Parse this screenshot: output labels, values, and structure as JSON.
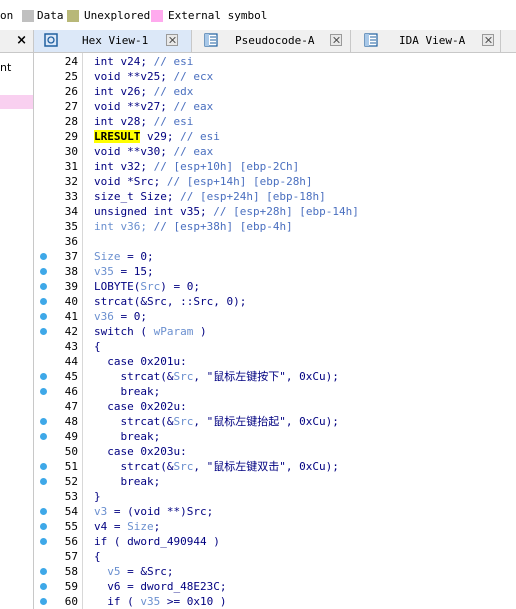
{
  "legend": [
    {
      "label": "on",
      "color": null
    },
    {
      "label": "Data",
      "color": "#c0c0c0"
    },
    {
      "label": "Unexplored",
      "color": "#b8b878"
    },
    {
      "label": "External symbol",
      "color": "#ffaaee"
    }
  ],
  "left_panel": {
    "close_glyph": "×",
    "fragment": "nt"
  },
  "tabs": [
    {
      "label": "Hex View-1",
      "icon": "hex-view-icon",
      "active": true
    },
    {
      "label": "Pseudocode-A",
      "icon": "pseudocode-icon",
      "active": false
    },
    {
      "label": "IDA View-A",
      "icon": "ida-view-icon",
      "active": false
    }
  ],
  "colors": {
    "breakpoint_dot": "#3ea8e8",
    "keyword": "#000080",
    "comment": "#4a6fbf",
    "highlight": "#ffff00"
  },
  "code_lines": [
    {
      "n": "24",
      "dot": false,
      "parts": [
        [
          "t",
          "int v24; "
        ],
        [
          "c",
          "// esi"
        ]
      ]
    },
    {
      "n": "25",
      "dot": false,
      "parts": [
        [
          "t",
          "void **v25; "
        ],
        [
          "c",
          "// ecx"
        ]
      ]
    },
    {
      "n": "26",
      "dot": false,
      "parts": [
        [
          "t",
          "int v26; "
        ],
        [
          "c",
          "// edx"
        ]
      ]
    },
    {
      "n": "27",
      "dot": false,
      "parts": [
        [
          "t",
          "void **v27; "
        ],
        [
          "c",
          "// eax"
        ]
      ]
    },
    {
      "n": "28",
      "dot": false,
      "parts": [
        [
          "t",
          "int v28; "
        ],
        [
          "c",
          "// esi"
        ]
      ]
    },
    {
      "n": "29",
      "dot": false,
      "parts": [
        [
          "h",
          "LRESULT"
        ],
        [
          "t",
          " v29; "
        ],
        [
          "c",
          "// esi"
        ]
      ]
    },
    {
      "n": "30",
      "dot": false,
      "parts": [
        [
          "t",
          "void **v30; "
        ],
        [
          "c",
          "// eax"
        ]
      ]
    },
    {
      "n": "31",
      "dot": false,
      "parts": [
        [
          "t",
          "int v32; "
        ],
        [
          "c",
          "// [esp+10h] [ebp-2Ch]"
        ]
      ]
    },
    {
      "n": "32",
      "dot": false,
      "parts": [
        [
          "t",
          "void *Src; "
        ],
        [
          "c",
          "// [esp+14h] [ebp-28h]"
        ]
      ]
    },
    {
      "n": "33",
      "dot": false,
      "parts": [
        [
          "t",
          "size_t Size; "
        ],
        [
          "c",
          "// [esp+24h] [ebp-18h]"
        ]
      ]
    },
    {
      "n": "34",
      "dot": false,
      "parts": [
        [
          "t",
          "unsigned int v35; "
        ],
        [
          "c",
          "// [esp+28h] [ebp-14h]"
        ]
      ]
    },
    {
      "n": "35",
      "dot": false,
      "parts": [
        [
          "g",
          "int v36; "
        ],
        [
          "c",
          "// [esp+38h] [ebp-4h]"
        ]
      ]
    },
    {
      "n": "36",
      "dot": false,
      "parts": []
    },
    {
      "n": "37",
      "dot": true,
      "parts": [
        [
          "g",
          "Size"
        ],
        [
          "t",
          " = 0;"
        ]
      ]
    },
    {
      "n": "38",
      "dot": true,
      "parts": [
        [
          "g",
          "v35"
        ],
        [
          "t",
          " = 15;"
        ]
      ]
    },
    {
      "n": "39",
      "dot": true,
      "parts": [
        [
          "t",
          "LOBYTE("
        ],
        [
          "g",
          "Src"
        ],
        [
          "t",
          ") = 0;"
        ]
      ]
    },
    {
      "n": "40",
      "dot": true,
      "parts": [
        [
          "t",
          "strcat(&Src, ::Src, 0);"
        ]
      ]
    },
    {
      "n": "41",
      "dot": true,
      "parts": [
        [
          "g",
          "v36"
        ],
        [
          "t",
          " = 0;"
        ]
      ]
    },
    {
      "n": "42",
      "dot": true,
      "parts": [
        [
          "t",
          "switch ( "
        ],
        [
          "g",
          "wParam"
        ],
        [
          "t",
          " )"
        ]
      ]
    },
    {
      "n": "43",
      "dot": false,
      "parts": [
        [
          "t",
          "{"
        ]
      ]
    },
    {
      "n": "44",
      "dot": false,
      "parts": [
        [
          "t",
          "  case 0x201u:"
        ]
      ]
    },
    {
      "n": "45",
      "dot": true,
      "parts": [
        [
          "t",
          "    strcat(&"
        ],
        [
          "g",
          "Src"
        ],
        [
          "t",
          ", \"鼠标左键按下\", 0xCu);"
        ]
      ]
    },
    {
      "n": "46",
      "dot": true,
      "parts": [
        [
          "t",
          "    break;"
        ]
      ]
    },
    {
      "n": "47",
      "dot": false,
      "parts": [
        [
          "t",
          "  case 0x202u:"
        ]
      ]
    },
    {
      "n": "48",
      "dot": true,
      "parts": [
        [
          "t",
          "    strcat(&"
        ],
        [
          "g",
          "Src"
        ],
        [
          "t",
          ", \"鼠标左键抬起\", 0xCu);"
        ]
      ]
    },
    {
      "n": "49",
      "dot": true,
      "parts": [
        [
          "t",
          "    break;"
        ]
      ]
    },
    {
      "n": "50",
      "dot": false,
      "parts": [
        [
          "t",
          "  case 0x203u:"
        ]
      ]
    },
    {
      "n": "51",
      "dot": true,
      "parts": [
        [
          "t",
          "    strcat(&"
        ],
        [
          "g",
          "Src"
        ],
        [
          "t",
          ", \"鼠标左键双击\", 0xCu);"
        ]
      ]
    },
    {
      "n": "52",
      "dot": true,
      "parts": [
        [
          "t",
          "    break;"
        ]
      ]
    },
    {
      "n": "53",
      "dot": false,
      "parts": [
        [
          "t",
          "}"
        ]
      ]
    },
    {
      "n": "54",
      "dot": true,
      "parts": [
        [
          "g",
          "v3"
        ],
        [
          "t",
          " = (void **)Src;"
        ]
      ]
    },
    {
      "n": "55",
      "dot": true,
      "parts": [
        [
          "t",
          "v4 = "
        ],
        [
          "g",
          "Size"
        ],
        [
          "t",
          ";"
        ]
      ]
    },
    {
      "n": "56",
      "dot": true,
      "parts": [
        [
          "t",
          "if ( dword_490944 )"
        ]
      ]
    },
    {
      "n": "57",
      "dot": false,
      "parts": [
        [
          "t",
          "{"
        ]
      ]
    },
    {
      "n": "58",
      "dot": true,
      "parts": [
        [
          "t",
          "  "
        ],
        [
          "g",
          "v5"
        ],
        [
          "t",
          " = &Src;"
        ]
      ]
    },
    {
      "n": "59",
      "dot": true,
      "parts": [
        [
          "t",
          "  v6 = dword_48E23C;"
        ]
      ]
    },
    {
      "n": "60",
      "dot": true,
      "parts": [
        [
          "t",
          "  if ( "
        ],
        [
          "g",
          "v35"
        ],
        [
          "t",
          " >= 0x10 )"
        ]
      ]
    }
  ]
}
